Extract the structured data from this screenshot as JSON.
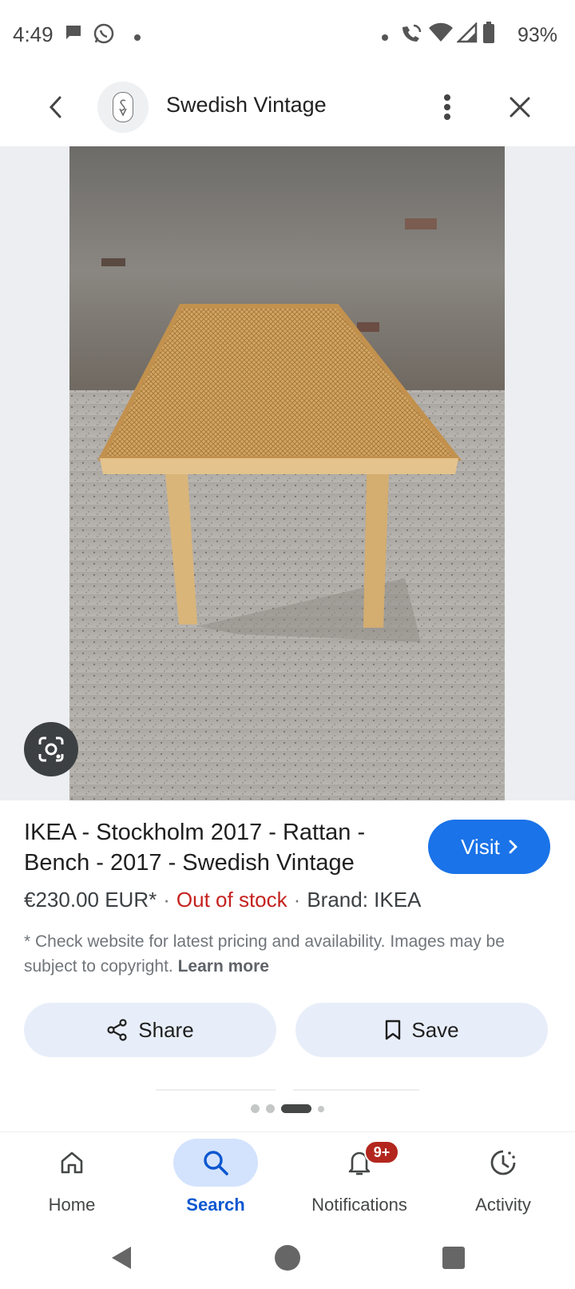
{
  "status_bar": {
    "time": "4:49",
    "battery": "93%"
  },
  "header": {
    "site_name": "Swedish Vintage"
  },
  "product": {
    "title": "IKEA - Stockholm 2017 - Rattan - Bench - 2017 - Swedish Vintage",
    "visit_label": "Visit",
    "price": "€230.00 EUR*",
    "stock_status": "Out of stock",
    "brand": "Brand: IKEA",
    "disclaimer": "* Check website for latest pricing and availability. Images may be subject to copyright.",
    "learn_more": "Learn more"
  },
  "actions": {
    "share_label": "Share",
    "save_label": "Save"
  },
  "bottom_nav": {
    "items": [
      {
        "label": "Home",
        "icon": "home-icon"
      },
      {
        "label": "Search",
        "icon": "search-icon",
        "active": true
      },
      {
        "label": "Notifications",
        "icon": "bell-icon",
        "badge": "9+"
      },
      {
        "label": "Activity",
        "icon": "activity-icon"
      }
    ]
  },
  "colors": {
    "accent": "#1a73e8",
    "out_of_stock": "#c5221f",
    "badge": "#b3261e",
    "active_nav_bg": "#d3e3fd"
  }
}
